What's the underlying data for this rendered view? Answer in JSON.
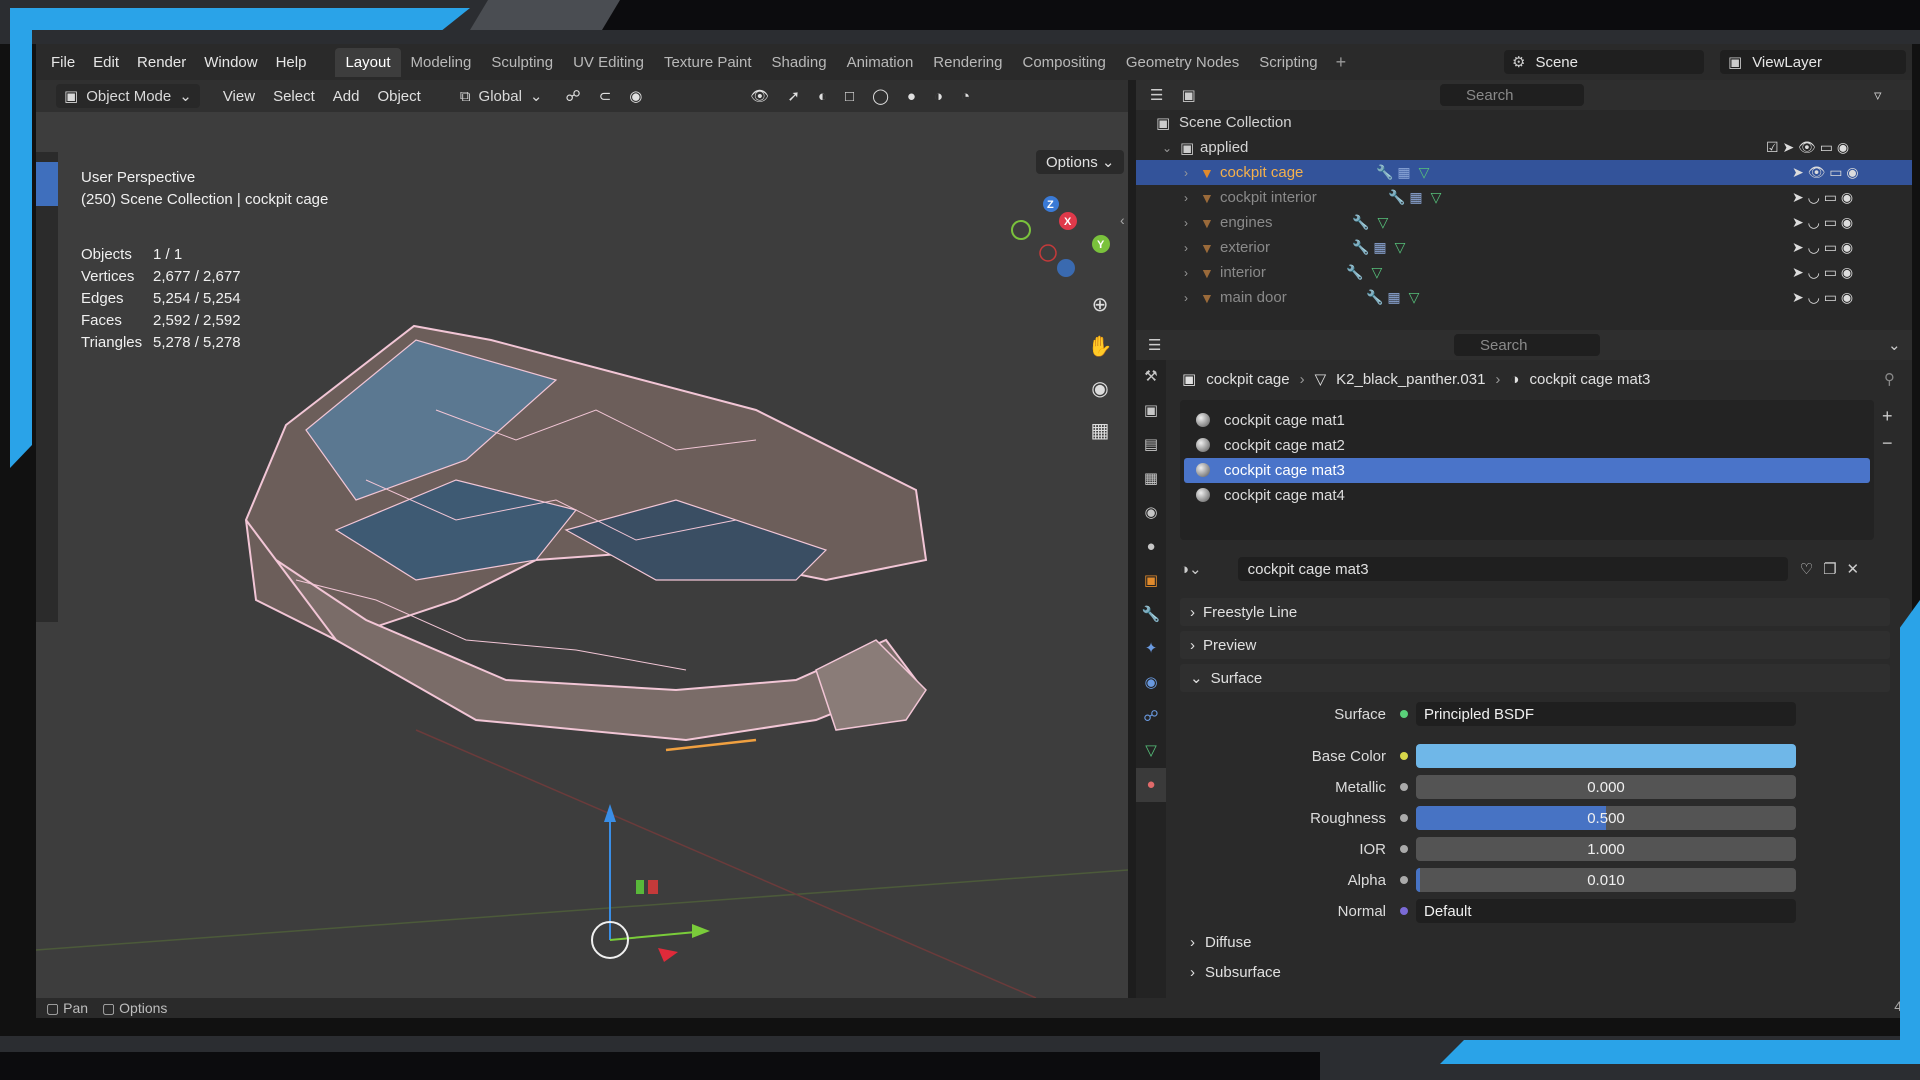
{
  "menu": [
    "File",
    "Edit",
    "Render",
    "Window",
    "Help"
  ],
  "workspace_tabs": [
    "Layout",
    "Modeling",
    "Sculpting",
    "UV Editing",
    "Texture Paint",
    "Shading",
    "Animation",
    "Rendering",
    "Compositing",
    "Geometry Nodes",
    "Scripting"
  ],
  "scene": "Scene",
  "view_layer": "ViewLayer",
  "viewport": {
    "mode": "Object Mode",
    "menus": [
      "View",
      "Select",
      "Add",
      "Object"
    ],
    "transform_orientation": "Global",
    "options_label": "Options",
    "perspective": "User Perspective",
    "collection_info": "(250) Scene Collection | cockpit cage",
    "stats": [
      {
        "label": "Objects",
        "value": "1 / 1"
      },
      {
        "label": "Vertices",
        "value": "2,677 / 2,677"
      },
      {
        "label": "Edges",
        "value": "5,254 / 5,254"
      },
      {
        "label": "Faces",
        "value": "2,592 / 2,592"
      },
      {
        "label": "Triangles",
        "value": "5,278 / 5,278"
      }
    ],
    "gizmo_axes": [
      "X",
      "Y",
      "Z"
    ]
  },
  "outliner": {
    "search_placeholder": "Search",
    "root": "Scene Collection",
    "collection": "applied",
    "objects": [
      "cockpit cage",
      "cockpit interior",
      "engines",
      "exterior",
      "interior",
      "main door"
    ]
  },
  "properties": {
    "search_placeholder": "Search",
    "breadcrumb": [
      "cockpit cage",
      "K2_black_panther.031",
      "cockpit cage mat3"
    ],
    "materials": [
      "cockpit cage mat1",
      "cockpit cage mat2",
      "cockpit cage mat3",
      "cockpit cage mat4"
    ],
    "active_material": "cockpit cage mat3",
    "panels": {
      "freestyle": "Freestyle Line",
      "preview": "Preview",
      "surface": "Surface",
      "diffuse": "Diffuse",
      "subsurface": "Subsurface"
    },
    "surface_label": "Surface",
    "surface_shader": "Principled BSDF",
    "base_color_label": "Base Color",
    "base_color": "#6fb7e8",
    "fields": [
      {
        "label": "Metallic",
        "value": "0.000",
        "fraction": 0.0
      },
      {
        "label": "Roughness",
        "value": "0.500",
        "fraction": 0.5
      },
      {
        "label": "IOR",
        "value": "1.000",
        "fraction": 0.0
      },
      {
        "label": "Alpha",
        "value": "0.010",
        "fraction": 0.01
      }
    ],
    "normal_label": "Normal",
    "normal_value": "Default"
  },
  "statusbar": {
    "pan": "Pan",
    "options": "Options",
    "number": "4"
  },
  "colors": {
    "accent": "#2aa3e8",
    "selection": "#33539a",
    "orange": "#f4b04c"
  }
}
